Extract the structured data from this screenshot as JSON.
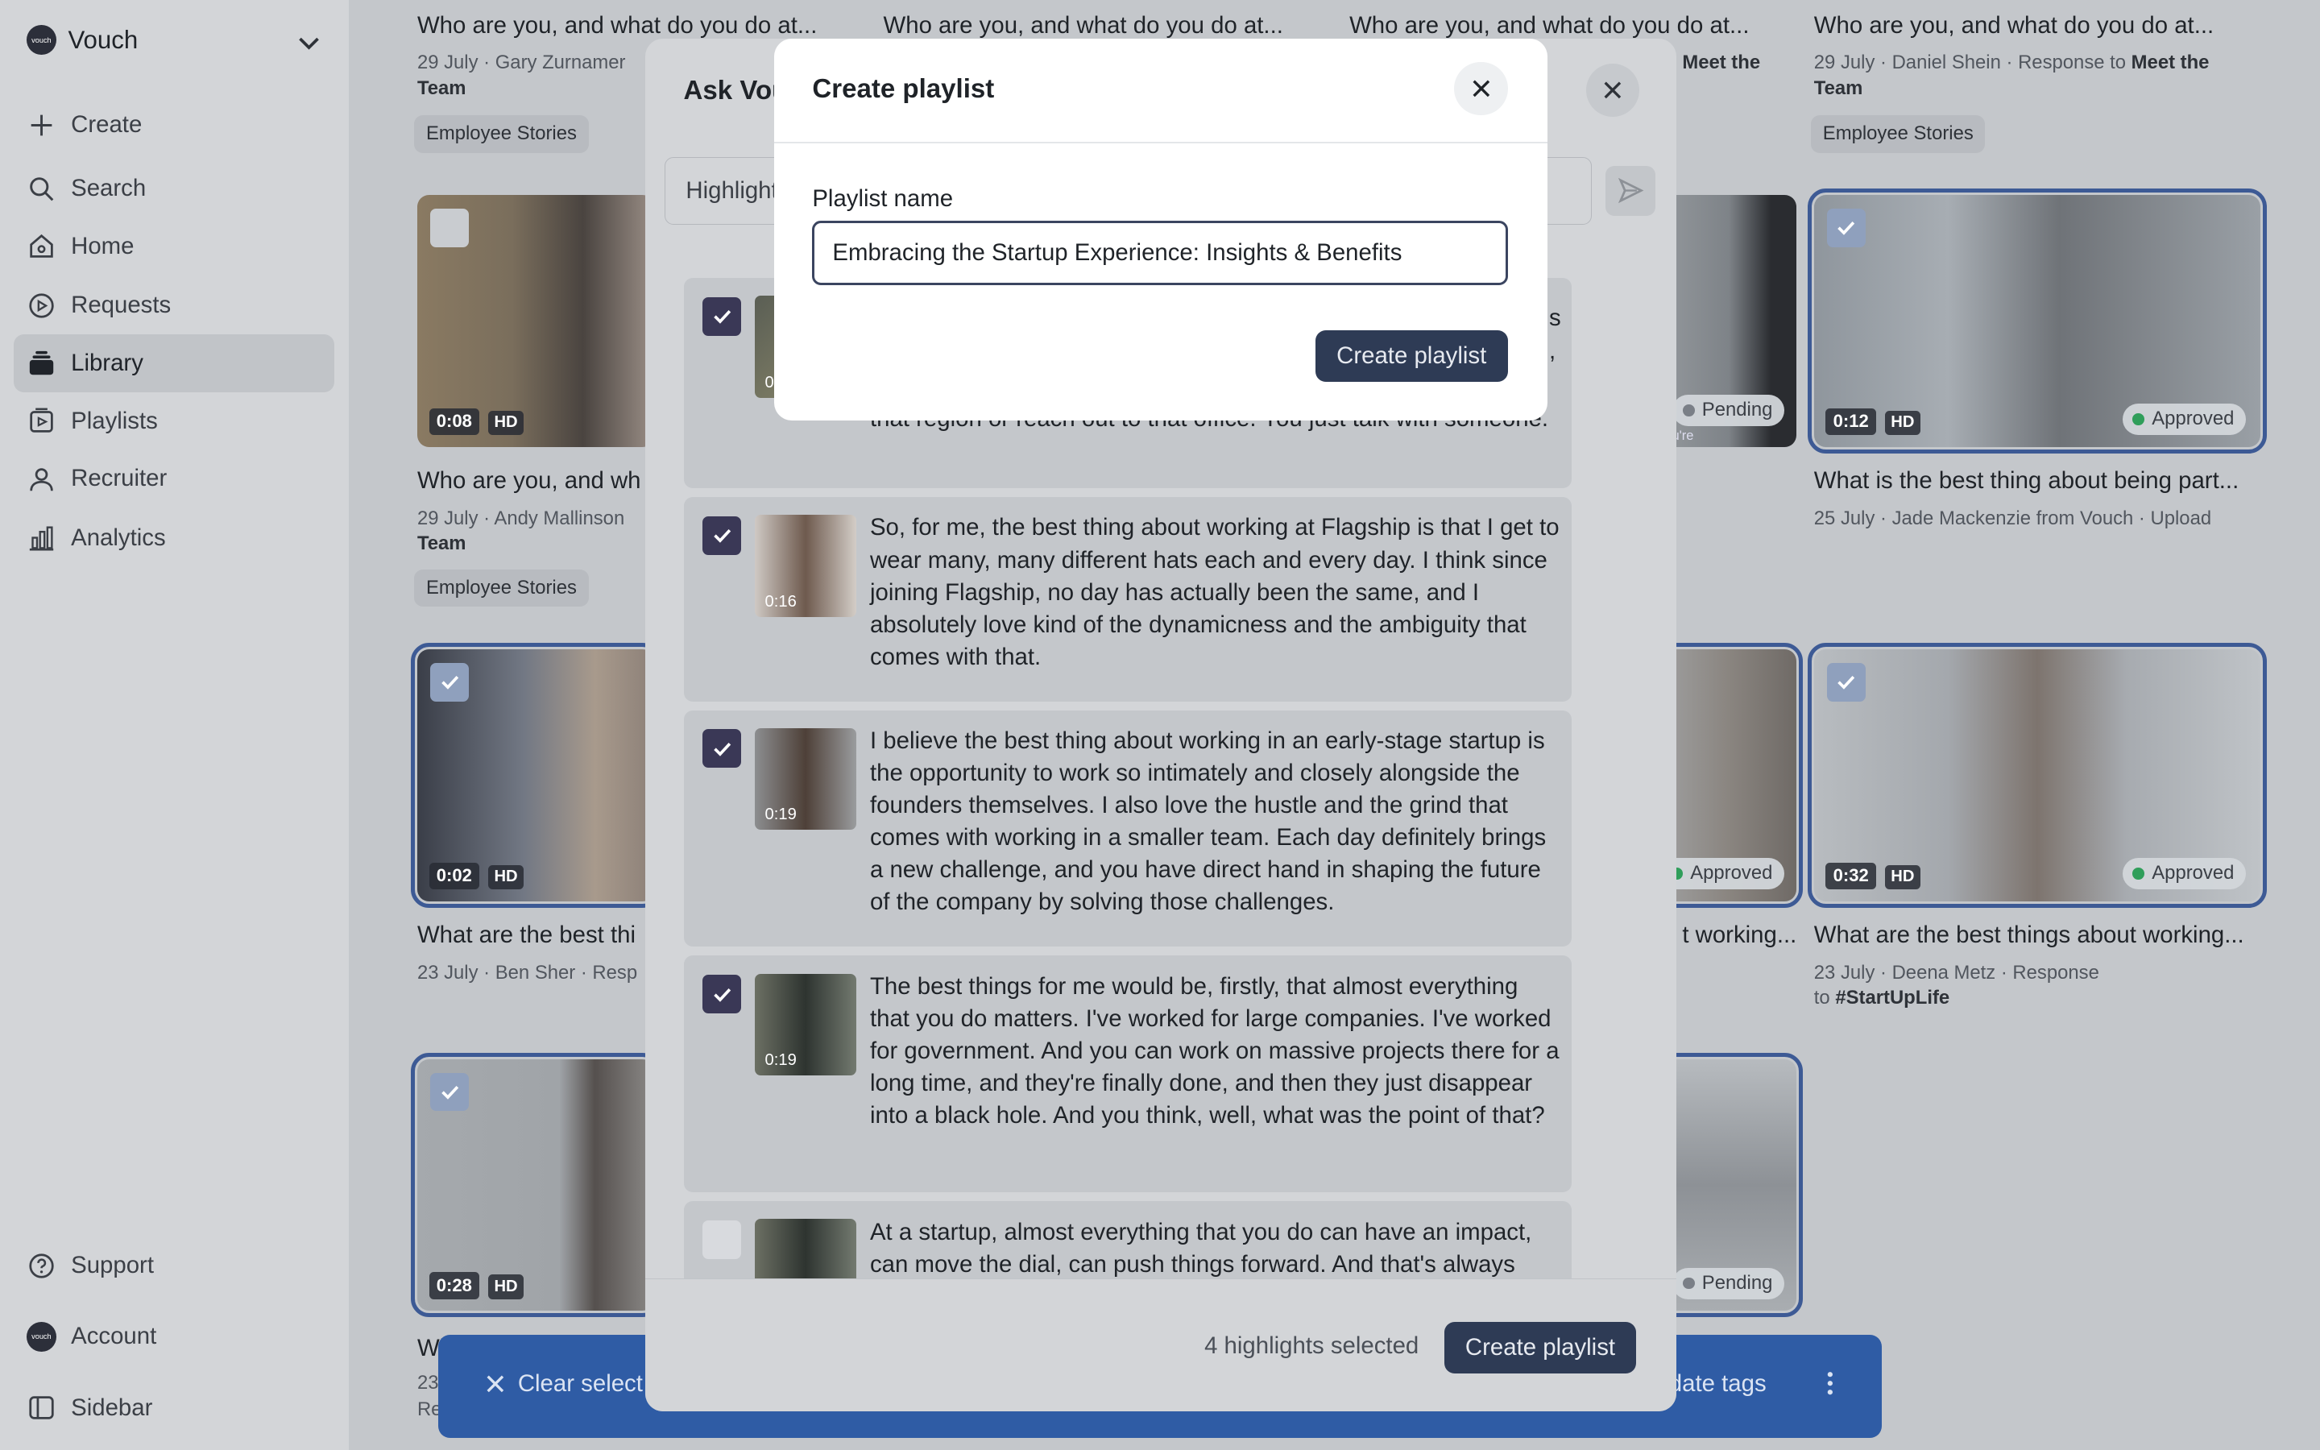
{
  "sidebar": {
    "workspace": "Vouch",
    "logo_text": "vouch",
    "items": [
      {
        "label": "Create",
        "icon": "plus-icon"
      },
      {
        "label": "Search",
        "icon": "search-icon"
      },
      {
        "label": "Home",
        "icon": "home-icon"
      },
      {
        "label": "Requests",
        "icon": "requests-icon"
      },
      {
        "label": "Library",
        "icon": "library-icon",
        "active": true
      },
      {
        "label": "Playlists",
        "icon": "playlists-icon"
      },
      {
        "label": "Recruiter",
        "icon": "recruiter-icon"
      },
      {
        "label": "Analytics",
        "icon": "analytics-icon"
      }
    ],
    "bottom": [
      {
        "label": "Support",
        "icon": "help-icon"
      },
      {
        "label": "Account",
        "icon": "account-avatar"
      },
      {
        "label": "Sidebar",
        "icon": "sidebar-icon"
      }
    ]
  },
  "library": {
    "row1": [
      {
        "title": "Who are you, and what do you do at...",
        "meta": "29 July · Gary Zurnamer",
        "meta2": "Team",
        "tag": "Employee Stories"
      },
      {
        "title": "Who are you, and what do you do at..."
      },
      {
        "title": "Who are you, and what do you do at...",
        "meta_end": "Meet the"
      },
      {
        "title": "Who are you, and what do you do at...",
        "meta": "29 July · Daniel Shein · Response to ",
        "meta_bold": "Meet the",
        "meta2": "Team",
        "tag": "Employee Stories"
      }
    ],
    "row2": [
      {
        "duration": "0:08",
        "hd": "HD",
        "title": "Who are you, and wh",
        "meta": "29 July · Andy Mallinson",
        "meta2": "Team",
        "tag": "Employee Stories"
      },
      {
        "status": "Pending",
        "sub": "u're"
      },
      {
        "duration": "0:12",
        "hd": "HD",
        "status": "Approved",
        "title": "What is the best thing about being part...",
        "meta": "25 July · Jade Mackenzie from Vouch · Upload"
      }
    ],
    "row3": [
      {
        "duration": "0:02",
        "hd": "HD",
        "title": "What are the best thi",
        "meta": "23 July · Ben Sher · Resp"
      },
      {
        "status": "Approved",
        "title": "t working..."
      },
      {
        "duration": "0:32",
        "hd": "HD",
        "status": "Approved",
        "title": "What are the best things about working...",
        "meta": "23 July · Deena Metz · Response",
        "meta2_pre": "to ",
        "meta2_bold": "#StartUpLife"
      }
    ],
    "row4": [
      {
        "duration": "0:28",
        "hd": "HD",
        "title": "Wi",
        "meta": "23",
        "meta2": "Re"
      },
      {
        "status": "Pending"
      }
    ]
  },
  "actionbar": {
    "clear": "Clear select",
    "update": "date tags"
  },
  "ask": {
    "title": "Ask Vou",
    "input_value": "Highlight",
    "highlights": [
      {
        "checked": true,
        "duration": "0",
        "text": "that region or reach out to that office. You just talk with someone.",
        "line1": "s",
        "line2": ","
      },
      {
        "checked": true,
        "duration": "0:16",
        "text": "So, for me, the best thing about working at Flagship is that I get to wear many, many different hats each and every day. I think since joining Flagship, no day has actually been the same, and I absolutely love kind of the dynamicness and the ambiguity that comes with that."
      },
      {
        "checked": true,
        "duration": "0:19",
        "text": "I believe the best thing about working in an early-stage startup is the opportunity to work so intimately and closely alongside the founders themselves. I also love the hustle and the grind that comes with working in a smaller team. Each day definitely brings a new challenge, and you have direct hand in shaping the future of the company by solving those challenges."
      },
      {
        "checked": true,
        "duration": "0:19",
        "text": "The best things for me would be, firstly, that almost everything that you do matters. I've worked for large companies. I've worked for government. And you can work on massive projects there for a long time, and they're finally done, and then they just disappear into a black hole. And you think, well, what was the point of that?"
      },
      {
        "checked": false,
        "duration": "",
        "text": "At a startup, almost everything that you do can have an impact, can move the dial, can push things forward. And that's always"
      }
    ],
    "selected_count": "4 highlights selected",
    "create_button": "Create playlist"
  },
  "dialog": {
    "title": "Create playlist",
    "field_label": "Playlist name",
    "field_value": "Embracing the Startup Experience: Insights & Benefits",
    "submit": "Create playlist"
  },
  "colors": {
    "selected_outline": "#3d5a95",
    "approved_dot": "#2f9e5a",
    "pending_dot": "#7a7f87",
    "primary_button": "#2e3b55",
    "action_bar": "#2f5ca5"
  }
}
